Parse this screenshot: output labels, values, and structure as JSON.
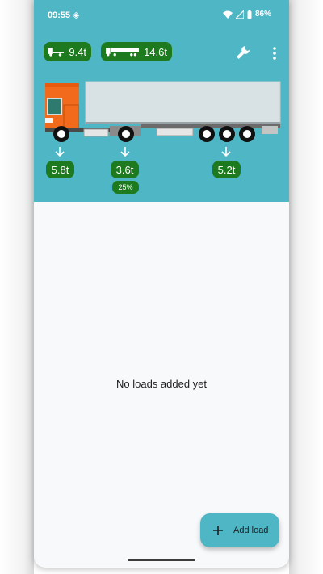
{
  "status_bar": {
    "time": "09:55",
    "battery": "86%"
  },
  "header": {
    "truck_weight": "9.4t",
    "trailer_weight": "14.6t"
  },
  "axles": [
    {
      "weight": "5.8t"
    },
    {
      "weight": "3.6t",
      "percent": "25%"
    },
    {
      "weight": "5.2t"
    }
  ],
  "main": {
    "empty_message": "No loads added yet"
  },
  "fab": {
    "label": "Add load"
  },
  "colors": {
    "header_bg": "#4eb6c5",
    "badge_green": "#1e7a1e",
    "cab_orange": "#f26a1b",
    "trailer_body": "#d8e1e4"
  }
}
